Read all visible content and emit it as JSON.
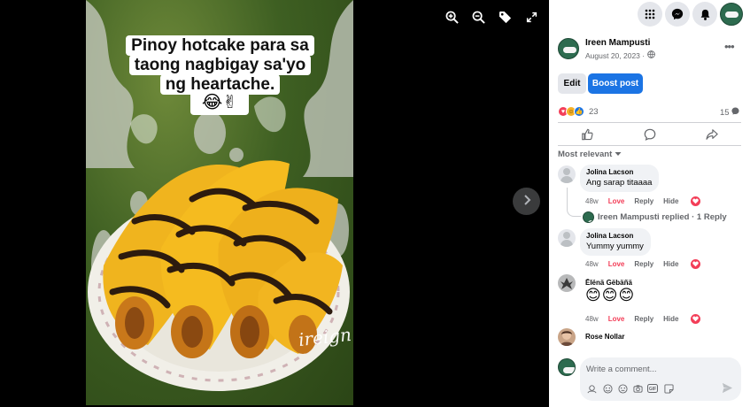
{
  "viewer": {
    "caption": "Pinoy hotcake para sa taong nagbigay sa'yo ng heartache.",
    "caption_emoji": "😂✌",
    "watermark": "ireign",
    "tools": [
      "zoom-in-icon",
      "zoom-out-icon",
      "tag-icon",
      "fullscreen-icon"
    ]
  },
  "topbar": {
    "icons": [
      "menu-grid-icon",
      "messenger-icon",
      "notifications-bell-icon",
      "profile-avatar"
    ]
  },
  "post": {
    "author": "Ireen Mampusti",
    "date": "August 20, 2023 ·",
    "privacy_icon": "globe-icon",
    "edit_label": "Edit",
    "boost_label": "Boost post",
    "reaction_count": "23",
    "comment_count": "15",
    "reaction_types": [
      "love",
      "haha",
      "like"
    ]
  },
  "comments": {
    "sort_label": "Most relevant",
    "items": [
      {
        "name": "Jolina Lacson",
        "text": "Ang sarap titaaaa",
        "time": "48w",
        "reaction": "Love",
        "reply": "Reply",
        "hide": "Hide"
      },
      {
        "name": "Jolina Lacson",
        "text": "Yummy yummy",
        "time": "48w",
        "reaction": "Love",
        "reply": "Reply",
        "hide": "Hide"
      },
      {
        "name": "Ēlënä Gëbäñä",
        "text": "😊😊😊",
        "time": "48w",
        "reaction": "Love",
        "reply": "Reply",
        "hide": "Hide"
      },
      {
        "name": "Rose Nollar"
      }
    ],
    "replied_text": "Ireen Mampusti replied · 1 Reply"
  },
  "composer": {
    "placeholder": "Write a comment...",
    "tools": [
      "avatar-sticker-icon",
      "emoji-icon",
      "smiley-icon",
      "camera-icon",
      "gif-icon",
      "sticker-icon"
    ],
    "send_icon": "send-icon"
  },
  "colors": {
    "accent": "#1b74e4",
    "love": "#f33e58",
    "panel_bg": "#ffffff",
    "bubble_bg": "#f0f2f5"
  }
}
